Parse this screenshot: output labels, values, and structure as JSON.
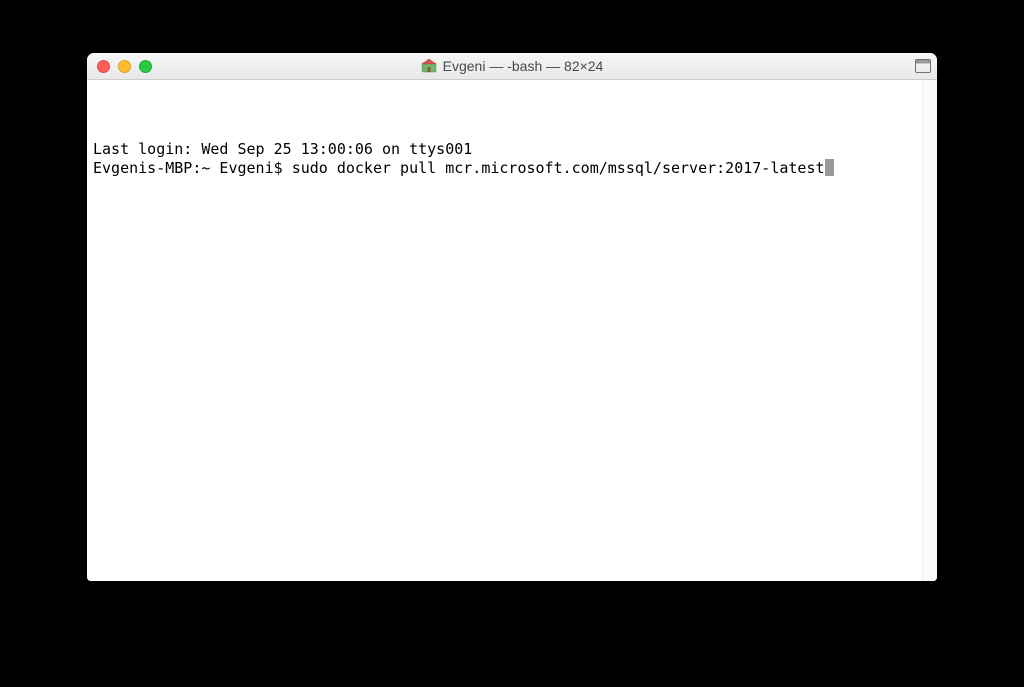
{
  "window": {
    "title": "Evgeni — -bash — 82×24"
  },
  "terminal": {
    "last_login": "Last login: Wed Sep 25 13:00:06 on ttys001",
    "prompt": "Evgenis-MBP:~ Evgeni$ ",
    "command": "sudo docker pull mcr.microsoft.com/mssql/server:2017-latest"
  }
}
